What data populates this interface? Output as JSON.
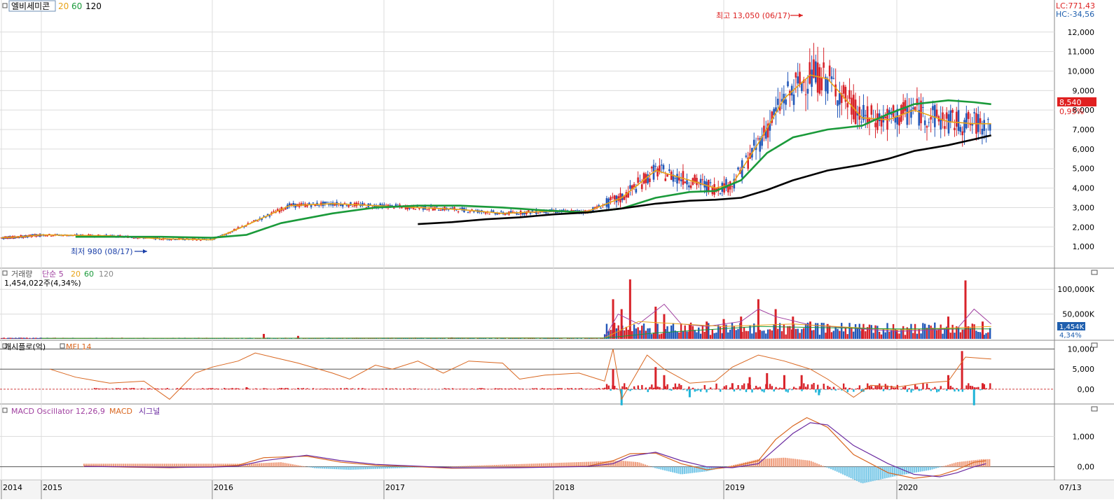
{
  "price_panel": {
    "stock_name": "엘비세미콘",
    "ma_labels": [
      "20",
      "60",
      "120"
    ],
    "ma_colors": [
      "#e8a317",
      "#1a9a3a",
      "#000000"
    ],
    "lc_text": "LC:771,43",
    "hc_text": "HC:-34,56",
    "current_price_badge": "8,540",
    "current_change_text": "0,95%",
    "high_annotation": "최고 13,050 (06/17)",
    "low_annotation": "최저 980 (08/17)"
  },
  "volume_panel": {
    "title": "거래량",
    "ma_prefix": "단순 5",
    "ma_periods": [
      "20",
      "60",
      "120"
    ],
    "sub_label": "1,454,022주(4,34%)",
    "value_badge": "1,454K",
    "pct_badge": "4,34%"
  },
  "cashflow_panel": {
    "title": "캐시플로(억)",
    "indicator": "MFI 14"
  },
  "macd_panel": {
    "title": "MACD Oscillator 12,26,9",
    "macd_label": "MACD",
    "signal_label": "시그널"
  },
  "x_axis": {
    "year_labels": [
      "2014",
      "2015",
      "2016",
      "2017",
      "2018",
      "2019",
      "2020"
    ],
    "right_date": "07/13"
  },
  "chart_data": [
    {
      "type": "line",
      "title": "엘비세미콘",
      "note": "candlestick price chart with moving averages 20/60/120",
      "x_unit": "year",
      "ylim": [
        0,
        13500
      ],
      "yticks": [
        1000,
        2000,
        3000,
        4000,
        5000,
        6000,
        7000,
        8000,
        9000,
        10000,
        11000,
        12000
      ],
      "ytick_labels": [
        "1,000",
        "2,000",
        "3,000",
        "4,000",
        "5,000",
        "6,000",
        "7,000",
        "8,000",
        "9,000",
        "10,000",
        "11,000",
        "12,000"
      ],
      "series": [
        {
          "name": "20",
          "color": "#e8a317",
          "x": [
            2014.0,
            2014.5,
            2015.0,
            2015.4,
            2015.7,
            2016.0,
            2016.2,
            2016.45,
            2016.7,
            2016.95,
            2017.2,
            2017.45,
            2017.7,
            2017.95,
            2018.2,
            2018.4,
            2018.6,
            2018.8,
            2018.95,
            2019.05,
            2019.2,
            2019.35,
            2019.5,
            2019.6,
            2019.8,
            2019.95,
            2020.1,
            2020.3,
            2020.45,
            2020.55
          ],
          "values": [
            1450,
            1500,
            1600,
            1550,
            1400,
            1350,
            2100,
            3100,
            3200,
            3100,
            3000,
            2900,
            2700,
            2800,
            2800,
            3500,
            4900,
            4400,
            4000,
            4200,
            6300,
            8600,
            9800,
            9600,
            7600,
            7500,
            8000,
            7400,
            7300,
            7300
          ]
        },
        {
          "name": "60",
          "color": "#1a9a3a",
          "x": [
            2015.2,
            2015.5,
            2015.7,
            2016.0,
            2016.2,
            2016.4,
            2016.7,
            2016.95,
            2017.2,
            2017.45,
            2017.7,
            2017.95,
            2018.2,
            2018.4,
            2018.6,
            2018.8,
            2018.95,
            2019.1,
            2019.25,
            2019.4,
            2019.6,
            2019.8,
            2019.95,
            2020.1,
            2020.3,
            2020.45,
            2020.55
          ],
          "values": [
            1500,
            1500,
            1500,
            1450,
            1600,
            2200,
            2700,
            3000,
            3100,
            3100,
            3000,
            2850,
            2750,
            2950,
            3500,
            3800,
            3850,
            4400,
            5800,
            6600,
            7000,
            7200,
            7800,
            8300,
            8500,
            8400,
            8300
          ]
        },
        {
          "name": "120",
          "color": "#000000",
          "x": [
            2017.2,
            2017.4,
            2017.6,
            2017.8,
            2018.0,
            2018.2,
            2018.4,
            2018.6,
            2018.8,
            2018.95,
            2019.1,
            2019.25,
            2019.4,
            2019.6,
            2019.8,
            2019.95,
            2020.1,
            2020.3,
            2020.45,
            2020.55
          ],
          "values": [
            2150,
            2250,
            2400,
            2500,
            2650,
            2750,
            2950,
            3200,
            3350,
            3400,
            3500,
            3900,
            4400,
            4900,
            5200,
            5500,
            5900,
            6200,
            6500,
            6700
          ]
        }
      ],
      "annotations": [
        {
          "text": "최고 13,050 (06/17)",
          "x": 2019.45,
          "y": 13050
        },
        {
          "text": "최저 980 (08/17)",
          "x": 2015.62,
          "y": 980
        }
      ]
    },
    {
      "type": "bar",
      "title": "거래량",
      "ylim": [
        0,
        130000
      ],
      "yticks": [
        50000,
        100000
      ],
      "ytick_labels": [
        "50,000K",
        "100,000K"
      ],
      "x": [
        2015.6,
        2016.3,
        2016.5,
        2017.4,
        2018.35,
        2018.4,
        2018.45,
        2018.6,
        2018.65,
        2018.8,
        2018.9,
        2019.0,
        2019.1,
        2019.2,
        2019.3,
        2019.4,
        2019.5,
        2019.6,
        2019.8,
        2020.0,
        2020.3,
        2020.4,
        2020.5
      ],
      "values": [
        2000,
        10000,
        6000,
        3000,
        80000,
        60000,
        120000,
        65000,
        50000,
        30000,
        35000,
        40000,
        45000,
        80000,
        60000,
        45000,
        35000,
        30000,
        20000,
        18000,
        45000,
        118000,
        35000
      ],
      "ma_series": [
        {
          "name": "5",
          "color": "#a040a0",
          "x": [
            2015.0,
            2018.3,
            2018.38,
            2018.5,
            2018.65,
            2018.75,
            2018.9,
            2019.1,
            2019.2,
            2019.3,
            2019.5,
            2020.0,
            2020.35,
            2020.45,
            2020.55
          ],
          "values": [
            1000,
            2000,
            50000,
            30000,
            70000,
            30000,
            25000,
            35000,
            60000,
            45000,
            28000,
            15000,
            20000,
            60000,
            30000
          ]
        },
        {
          "name": "20",
          "color": "#e8a317",
          "x": [
            2015.0,
            2018.3,
            2018.5,
            2019.0,
            2019.4,
            2020.0,
            2020.55
          ],
          "values": [
            1000,
            2000,
            35000,
            25000,
            30000,
            18000,
            25000
          ]
        },
        {
          "name": "60",
          "color": "#1a9a3a",
          "x": [
            2015.0,
            2018.3,
            2018.6,
            2019.2,
            2020.0,
            2020.55
          ],
          "values": [
            1000,
            1500,
            12000,
            25000,
            20000,
            20000
          ]
        }
      ]
    },
    {
      "type": "bar",
      "title": "캐시플로(억)",
      "ylim": [
        -3500,
        12000
      ],
      "yticks": [
        0,
        5000,
        10000
      ],
      "ytick_labels": [
        "0,00",
        "5,000",
        "10,000"
      ],
      "x": [
        2016.2,
        2016.5,
        2018.35,
        2018.4,
        2018.6,
        2018.65,
        2018.8,
        2019.05,
        2019.15,
        2019.25,
        2019.35,
        2019.45,
        2019.55,
        2020.3,
        2020.38,
        2020.45,
        2020.5
      ],
      "values": [
        500,
        300,
        5000,
        -4000,
        5500,
        3500,
        -2000,
        1500,
        3000,
        4000,
        3500,
        3500,
        -1500,
        3500,
        9500,
        -4000,
        1500
      ],
      "mfi": {
        "name": "MFI 14",
        "color": "#d9661f",
        "x": [
          2015.05,
          2015.2,
          2015.4,
          2015.6,
          2015.75,
          2015.9,
          2016.0,
          2016.15,
          2016.25,
          2016.35,
          2016.5,
          2016.7,
          2016.8,
          2016.95,
          2017.05,
          2017.2,
          2017.35,
          2017.5,
          2017.7,
          2017.8,
          2017.95,
          2018.15,
          2018.3,
          2018.35,
          2018.4,
          2018.55,
          2018.65,
          2018.8,
          2018.95,
          2019.05,
          2019.2,
          2019.35,
          2019.5,
          2019.6,
          2019.75,
          2019.85,
          2020.0,
          2020.15,
          2020.3,
          2020.4,
          2020.55
        ],
        "values": [
          5000,
          3000,
          1500,
          2000,
          -2500,
          4000,
          5500,
          7000,
          9000,
          8000,
          6500,
          4000,
          2500,
          6000,
          5000,
          7000,
          4000,
          7000,
          6500,
          2500,
          3500,
          4000,
          2000,
          10000,
          -2500,
          8500,
          5000,
          1500,
          2000,
          5500,
          8500,
          7000,
          5000,
          2500,
          -2000,
          1000,
          500,
          1500,
          2000,
          8000,
          7500
        ]
      }
    },
    {
      "type": "line",
      "title": "MACD Oscillator 12,26,9",
      "ylim": [
        -400,
        2000
      ],
      "yticks": [
        0,
        1000
      ],
      "ytick_labels": [
        "0,00",
        "1,000"
      ],
      "series": [
        {
          "name": "MACD",
          "color": "#d9661f",
          "x": [
            2015.25,
            2015.5,
            2015.75,
            2016.0,
            2016.15,
            2016.3,
            2016.55,
            2016.75,
            2016.95,
            2017.2,
            2017.4,
            2017.6,
            2017.8,
            2018.0,
            2018.2,
            2018.35,
            2018.45,
            2018.6,
            2018.75,
            2018.9,
            2019.05,
            2019.2,
            2019.3,
            2019.4,
            2019.48,
            2019.6,
            2019.75,
            2019.95,
            2020.1,
            2020.25,
            2020.35,
            2020.45,
            2020.52
          ],
          "values": [
            20,
            -10,
            -30,
            0,
            50,
            300,
            350,
            150,
            50,
            0,
            -50,
            -40,
            -20,
            0,
            20,
            200,
            430,
            450,
            100,
            -100,
            0,
            200,
            900,
            1350,
            1620,
            1300,
            400,
            -200,
            -380,
            -280,
            -100,
            150,
            200
          ]
        },
        {
          "name": "시그널",
          "color": "#6a2aa0",
          "x": [
            2015.25,
            2015.5,
            2015.75,
            2016.0,
            2016.15,
            2016.3,
            2016.55,
            2016.75,
            2016.95,
            2017.2,
            2017.4,
            2017.6,
            2017.8,
            2018.0,
            2018.2,
            2018.35,
            2018.45,
            2018.6,
            2018.75,
            2018.9,
            2019.05,
            2019.2,
            2019.3,
            2019.4,
            2019.5,
            2019.6,
            2019.75,
            2019.95,
            2020.1,
            2020.25,
            2020.35,
            2020.45,
            2020.52
          ],
          "values": [
            10,
            0,
            -20,
            -10,
            20,
            200,
            380,
            200,
            80,
            20,
            -30,
            -40,
            -30,
            -10,
            10,
            100,
            350,
            480,
            200,
            0,
            -30,
            100,
            600,
            1100,
            1450,
            1380,
            700,
            100,
            -250,
            -330,
            -200,
            0,
            100
          ]
        }
      ],
      "oscillator": {
        "x": [
          2016.2,
          2016.4,
          2016.6,
          2016.8,
          2018.4,
          2018.5,
          2018.6,
          2018.75,
          2018.9,
          2019.2,
          2019.35,
          2019.5,
          2019.65,
          2019.8,
          2020.0,
          2020.2,
          2020.35,
          2020.5
        ],
        "values": [
          100,
          150,
          -50,
          -100,
          200,
          150,
          -50,
          -250,
          -150,
          250,
          300,
          200,
          -150,
          -550,
          -300,
          -100,
          150,
          250
        ]
      }
    }
  ]
}
